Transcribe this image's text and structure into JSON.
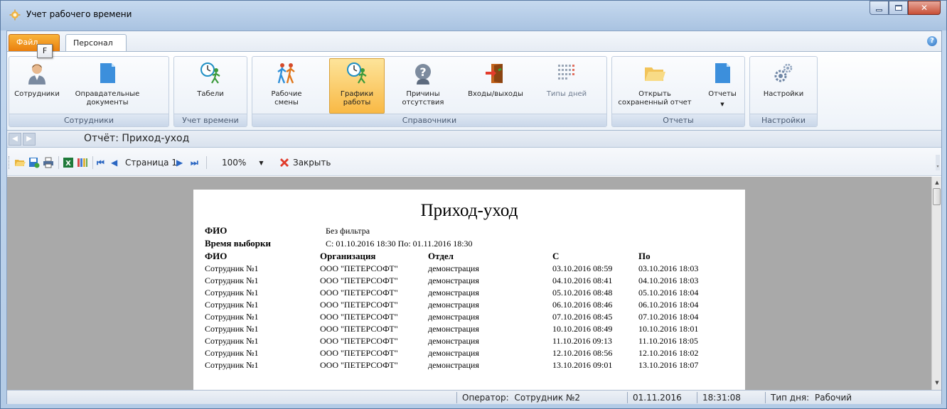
{
  "window": {
    "title": "Учет рабочего времени"
  },
  "ribbon": {
    "file_tab": "Файл",
    "tooltip_key": "F",
    "active_tab": "Персонал",
    "groups": [
      {
        "label": "Сотрудники",
        "buttons": [
          "Сотрудники",
          "Оправдательные документы"
        ]
      },
      {
        "label": "Учет времени",
        "buttons": [
          "Табели"
        ]
      },
      {
        "label": "Справочники",
        "buttons": [
          "Рабочие смены",
          "Графики работы",
          "Причины отсутствия",
          "Входы/выходы",
          "Типы дней"
        ]
      },
      {
        "label": "Отчеты",
        "buttons": [
          "Открыть сохраненный отчет",
          "Отчеты"
        ]
      },
      {
        "label": "Настройки",
        "buttons": [
          "Настройки"
        ]
      }
    ]
  },
  "breadcrumb": {
    "title": "Отчёт: Приход-уход"
  },
  "toolbar": {
    "page_label": "Страница 1",
    "zoom": "100%",
    "close_label": "Закрыть"
  },
  "report": {
    "title": "Приход-уход",
    "meta": [
      {
        "label": "ФИО",
        "value": "Без фильтра"
      },
      {
        "label": "Время выборки",
        "value": "С: 01.10.2016 18:30 По: 01.11.2016 18:30"
      }
    ],
    "columns": [
      "ФИО",
      "Организация",
      "Отдел",
      "С",
      "По"
    ],
    "rows": [
      [
        "Сотрудник №1",
        "ООО \"ПЕТЕРСОФТ\"",
        "демонстрация",
        "03.10.2016 08:59",
        "03.10.2016 18:03"
      ],
      [
        "Сотрудник №1",
        "ООО \"ПЕТЕРСОФТ\"",
        "демонстрация",
        "04.10.2016 08:41",
        "04.10.2016 18:03"
      ],
      [
        "Сотрудник №1",
        "ООО \"ПЕТЕРСОФТ\"",
        "демонстрация",
        "05.10.2016 08:48",
        "05.10.2016 18:04"
      ],
      [
        "Сотрудник №1",
        "ООО \"ПЕТЕРСОФТ\"",
        "демонстрация",
        "06.10.2016 08:46",
        "06.10.2016 18:04"
      ],
      [
        "Сотрудник №1",
        "ООО \"ПЕТЕРСОФТ\"",
        "демонстрация",
        "07.10.2016 08:45",
        "07.10.2016 18:04"
      ],
      [
        "Сотрудник №1",
        "ООО \"ПЕТЕРСОФТ\"",
        "демонстрация",
        "10.10.2016 08:49",
        "10.10.2016 18:01"
      ],
      [
        "Сотрудник №1",
        "ООО \"ПЕТЕРСОФТ\"",
        "демонстрация",
        "11.10.2016 09:13",
        "11.10.2016 18:05"
      ],
      [
        "Сотрудник №1",
        "ООО \"ПЕТЕРСОФТ\"",
        "демонстрация",
        "12.10.2016 08:56",
        "12.10.2016 18:02"
      ],
      [
        "Сотрудник №1",
        "ООО \"ПЕТЕРСОФТ\"",
        "демонстрация",
        "13.10.2016 09:01",
        "13.10.2016 18:07"
      ]
    ]
  },
  "status": {
    "operator_label": "Оператор:",
    "operator": "Сотрудник №2",
    "date": "01.11.2016",
    "time": "18:31:08",
    "daytype_label": "Тип дня:",
    "daytype": "Рабочий"
  },
  "colors": {
    "file_tab": "#ea7f0e",
    "active_button": "#f9b945",
    "viewer_bg": "#a9a9a9"
  }
}
